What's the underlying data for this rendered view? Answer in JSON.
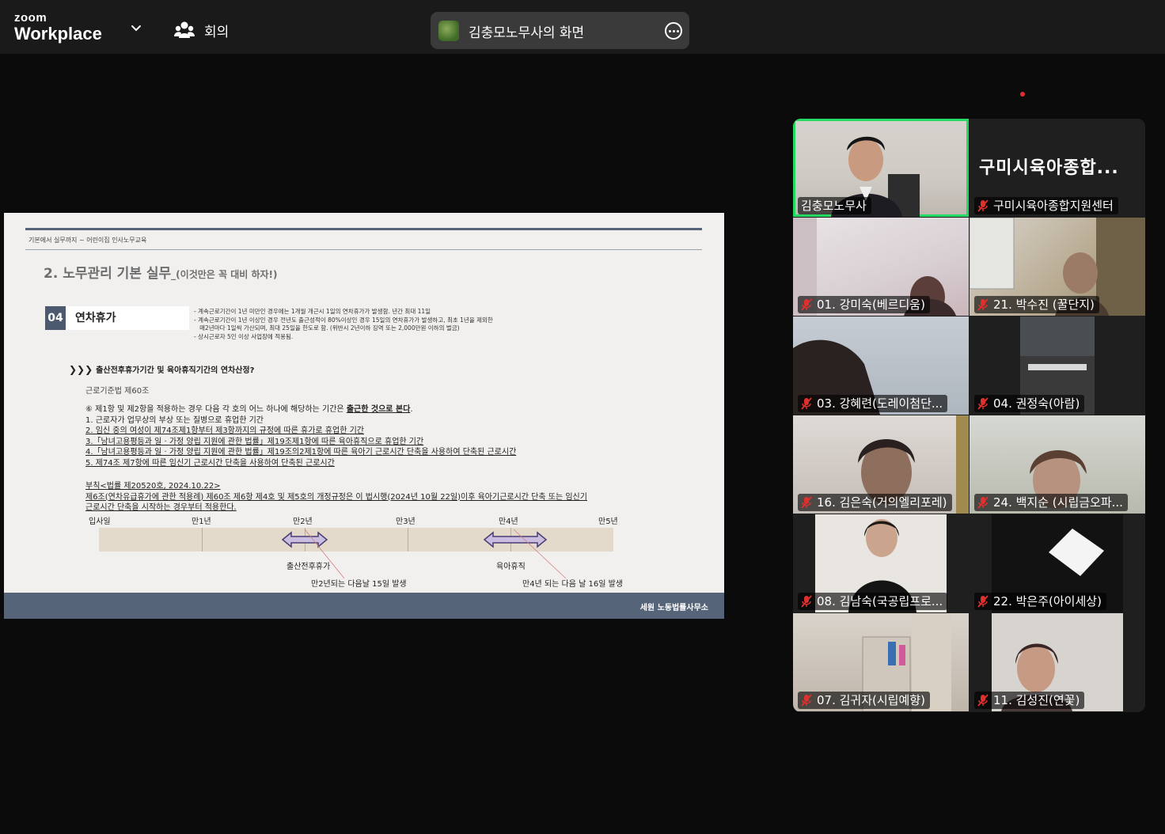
{
  "app": {
    "brand_top": "zoom",
    "brand_bottom": "Workplace"
  },
  "meeting": {
    "label": "회의"
  },
  "share": {
    "title": "김충모노무사의 화면"
  },
  "slide": {
    "breadcrumb": "기본에서 실무까지 ~ 어린이집 인사노무교육",
    "section_title": "2. 노무관리 기본 실무",
    "section_sub": "_(이것만은 꼭 대비 하자!)",
    "badge_number": "04",
    "badge_label": "연차휴가",
    "notes": [
      "- 계속근로기간이 1년 미만인 경우에는 1개월 개근시 1일의 연차휴가가 발생함. 년간 최대 11일",
      "- 계속근로기간이 1년 이상인 경우 전년도 출근성적이 80%이상인 경우 15일의 연차휴가가 발생하고, 최초 1년을 제외한",
      "   매2년마다 1일씩 가산되며, 최대 25일을 한도로 함. (위반시 2년이하 징역 또는 2,000만원 이하의 벌금)",
      "- 상시근로자 5인 이상 사업장에 적용됨."
    ],
    "question": "출산전후휴가기간 및 육아휴직기간의 연차산정?",
    "law": "근로기준법 제60조",
    "para_intro": "⑥ 제1항 및 제2항을 적용하는 경우 다음 각 호의 어느 하나에 해당하는 기간은 ",
    "para_bold": "출근한 것으로 본다",
    "para_items": [
      "1. 근로자가 업무상의 부상 또는 질병으로 휴업한 기간",
      "2. 임신 중의 여성이 제74조제1항부터 제3항까지의 규정에 따른 휴가로 휴업한 기간",
      "3.「남녀고용평등과 일 · 가정 양립 지원에 관한 법률」제19조제1항에 따른 육아휴직으로 휴업한 기간",
      "4.「남녀고용평등과 일 · 가정 양립 지원에 관한 법률」제19조의2제1항에 따른 육아기 근로시간 단축을 사용하여 단축된 근로시간",
      "5. 제74조 제7항에 따른 임신기 근로시간 단축을 사용하여 단축된 근로시간"
    ],
    "suppl": [
      "부칙<법률 제20520호, 2024.10.22>",
      "제6조(연차유급휴가에 관한 적용례) 제60조 제6항 제4호 및 제5호의 개정규정은 이 법시행(2024년 10월 22일)이후 육아기근로시간 단축 또는 임신기",
      "근로시간 단축을 시작하는 경우부터 적용한다."
    ],
    "timeline": {
      "ticks": [
        "입사일",
        "만1년",
        "만2년",
        "만3년",
        "만4년",
        "만5년"
      ],
      "cap_left": "출산전후휴가",
      "cap_left_note": "만2년되는 다음날 15일 발생",
      "cap_right": "육아휴직",
      "cap_right_note": "만4년 되는 다음 날 16일 발생"
    },
    "footer": "세원 노동법률사무소"
  },
  "gallery": {
    "big_label": "구미시육아종합...",
    "tiles": [
      {
        "name": "김충모노무사",
        "muted": false
      },
      {
        "name": "구미시육아종합지원센터",
        "muted": true
      },
      {
        "name": "01. 강미숙(베르디움)",
        "muted": true
      },
      {
        "name": "21. 박수진 (꿀단지)",
        "muted": true
      },
      {
        "name": "03. 강혜련(도레이첨단...",
        "muted": true
      },
      {
        "name": "04. 권정숙(아람)",
        "muted": true
      },
      {
        "name": "16. 김은숙(거의엘리포레)",
        "muted": true
      },
      {
        "name": "24. 백지순 (시립금오파...",
        "muted": true
      },
      {
        "name": "08. 김남숙(국공립프로...",
        "muted": true
      },
      {
        "name": "22. 박은주(아이세상)",
        "muted": true
      },
      {
        "name": "07. 김귀자(시립예향)",
        "muted": true
      },
      {
        "name": "11. 김성진(연꽃)",
        "muted": true
      }
    ]
  },
  "colors": {
    "active_speaker": "#23d962",
    "muted_icon": "#e0302d",
    "slide_accent": "#56647a"
  }
}
